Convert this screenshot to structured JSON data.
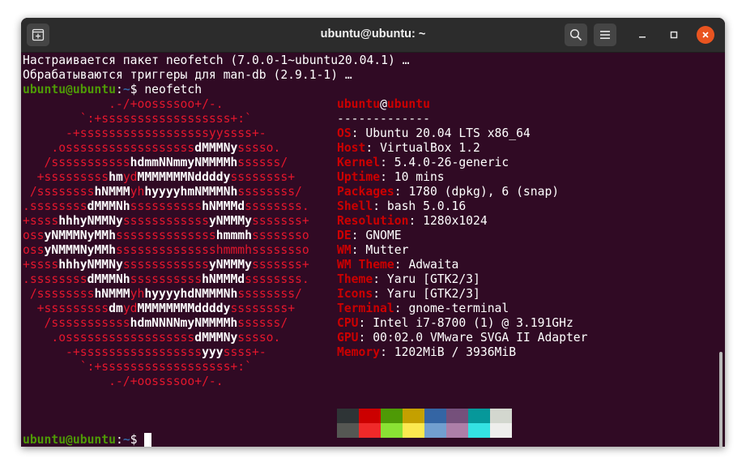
{
  "window": {
    "title": "ubuntu@ubuntu: ~"
  },
  "icons": {
    "new_tab": "new-tab-icon",
    "search": "search-icon",
    "menu": "hamburger-menu-icon",
    "minimize": "minimize-icon",
    "maximize": "maximize-icon",
    "close": "close-icon"
  },
  "output": {
    "line1": "Настраивается пакет neofetch (7.0.0-1~ubuntu20.04.1) …",
    "line2": "Обрабатываются триггеры для man-db (2.9.1-1) …"
  },
  "prompt": {
    "user_host": "ubuntu@ubuntu",
    "sep": ":",
    "path": "~",
    "symbol": "$ ",
    "command": "neofetch"
  },
  "prompt2": {
    "user_host": "ubuntu@ubuntu",
    "sep": ":",
    "path": "~",
    "symbol": "$ "
  },
  "logo": [
    [
      {
        "t": "            .-/+oossssoo+/-."
      }
    ],
    [
      {
        "t": "        `:+ssssssssssssssssss+:`"
      }
    ],
    [
      {
        "t": "      -+ssssssssssssssssssyyssss+-"
      }
    ],
    [
      {
        "t": "    .ossssssssssssssssss"
      },
      {
        "t": "dMMMNy",
        "w": 1
      },
      {
        "t": "sssso."
      }
    ],
    [
      {
        "t": "   /sssssssssss"
      },
      {
        "t": "hdmmNNmmyNMMMMh",
        "w": 1
      },
      {
        "t": "ssssss/"
      }
    ],
    [
      {
        "t": "  +sssssssss"
      },
      {
        "t": "hm",
        "w": 1
      },
      {
        "t": "yd"
      },
      {
        "t": "MMMMMMMNddddy",
        "w": 1
      },
      {
        "t": "ssssssss+"
      }
    ],
    [
      {
        "t": " /ssssssss"
      },
      {
        "t": "hNMMM",
        "w": 1
      },
      {
        "t": "yh"
      },
      {
        "t": "hyyyyhmNMMMNh",
        "w": 1
      },
      {
        "t": "ssssssss/"
      }
    ],
    [
      {
        "t": ".ssssssss"
      },
      {
        "t": "dMMMNh",
        "w": 1
      },
      {
        "t": "ssssssssss"
      },
      {
        "t": "hNMMMd",
        "w": 1
      },
      {
        "t": "ssssssss."
      }
    ],
    [
      {
        "t": "+ssss"
      },
      {
        "t": "hhhyNMMNy",
        "w": 1
      },
      {
        "t": "ssssssssssss"
      },
      {
        "t": "yNMMMy",
        "w": 1
      },
      {
        "t": "sssssss+"
      }
    ],
    [
      {
        "t": "oss"
      },
      {
        "t": "yNMMMNyMMh",
        "w": 1
      },
      {
        "t": "ssssssssssssss"
      },
      {
        "t": "hmmmh",
        "w": 1
      },
      {
        "t": "ssssssso"
      }
    ],
    [
      {
        "t": "oss"
      },
      {
        "t": "yNMMMNyMMh",
        "w": 1
      },
      {
        "t": "sssssssssssssshmmmhssssssso"
      }
    ],
    [
      {
        "t": "+ssss"
      },
      {
        "t": "hhhyNMMNy",
        "w": 1
      },
      {
        "t": "ssssssssssss"
      },
      {
        "t": "yNMMMy",
        "w": 1
      },
      {
        "t": "sssssss+"
      }
    ],
    [
      {
        "t": ".ssssssss"
      },
      {
        "t": "dMMMNh",
        "w": 1
      },
      {
        "t": "ssssssssss"
      },
      {
        "t": "hNMMMd",
        "w": 1
      },
      {
        "t": "ssssssss."
      }
    ],
    [
      {
        "t": " /ssssssss"
      },
      {
        "t": "hNMMM",
        "w": 1
      },
      {
        "t": "yh"
      },
      {
        "t": "hyyyyhdNMMMNh",
        "w": 1
      },
      {
        "t": "ssssssss/"
      }
    ],
    [
      {
        "t": "  +sssssssss"
      },
      {
        "t": "dm",
        "w": 1
      },
      {
        "t": "yd"
      },
      {
        "t": "MMMMMMMMddddy",
        "w": 1
      },
      {
        "t": "ssssssss+"
      }
    ],
    [
      {
        "t": "   /sssssssssss"
      },
      {
        "t": "hdmNNNNmyNMMMMh",
        "w": 1
      },
      {
        "t": "ssssss/"
      }
    ],
    [
      {
        "t": "    .ossssssssssssssssss"
      },
      {
        "t": "dMMMNy",
        "w": 1
      },
      {
        "t": "sssso."
      }
    ],
    [
      {
        "t": "      -+sssssssssssssssss"
      },
      {
        "t": "yyy",
        "w": 1
      },
      {
        "t": "ssss+-"
      }
    ],
    [
      {
        "t": "        `:+ssssssssssssssssss+:`"
      }
    ],
    [
      {
        "t": "            .-/+oossssoo+/-."
      }
    ]
  ],
  "info": {
    "user": "ubuntu",
    "at": "@",
    "host": "ubuntu",
    "separator": "-------------",
    "rows": [
      {
        "key": "OS",
        "value": "Ubuntu 20.04 LTS x86_64"
      },
      {
        "key": "Host",
        "value": "VirtualBox 1.2"
      },
      {
        "key": "Kernel",
        "value": "5.4.0-26-generic"
      },
      {
        "key": "Uptime",
        "value": "10 mins"
      },
      {
        "key": "Packages",
        "value": "1780 (dpkg), 6 (snap)"
      },
      {
        "key": "Shell",
        "value": "bash 5.0.16"
      },
      {
        "key": "Resolution",
        "value": "1280x1024"
      },
      {
        "key": "DE",
        "value": "GNOME"
      },
      {
        "key": "WM",
        "value": "Mutter"
      },
      {
        "key": "WM Theme",
        "value": "Adwaita"
      },
      {
        "key": "Theme",
        "value": "Yaru [GTK2/3]"
      },
      {
        "key": "Icons",
        "value": "Yaru [GTK2/3]"
      },
      {
        "key": "Terminal",
        "value": "gnome-terminal"
      },
      {
        "key": "CPU",
        "value": "Intel i7-8700 (1) @ 3.191GHz"
      },
      {
        "key": "GPU",
        "value": "00:02.0 VMware SVGA II Adapter"
      },
      {
        "key": "Memory",
        "value": "1202MiB / 3936MiB"
      }
    ]
  },
  "palette": {
    "normal": [
      "#2e3436",
      "#cc0000",
      "#4e9a06",
      "#c4a000",
      "#3465a4",
      "#75507b",
      "#06989a",
      "#d3d7cf"
    ],
    "bright": [
      "#555753",
      "#ef2929",
      "#8ae234",
      "#fce94f",
      "#729fcf",
      "#ad7fa8",
      "#34e2e2",
      "#eeeeec"
    ]
  }
}
